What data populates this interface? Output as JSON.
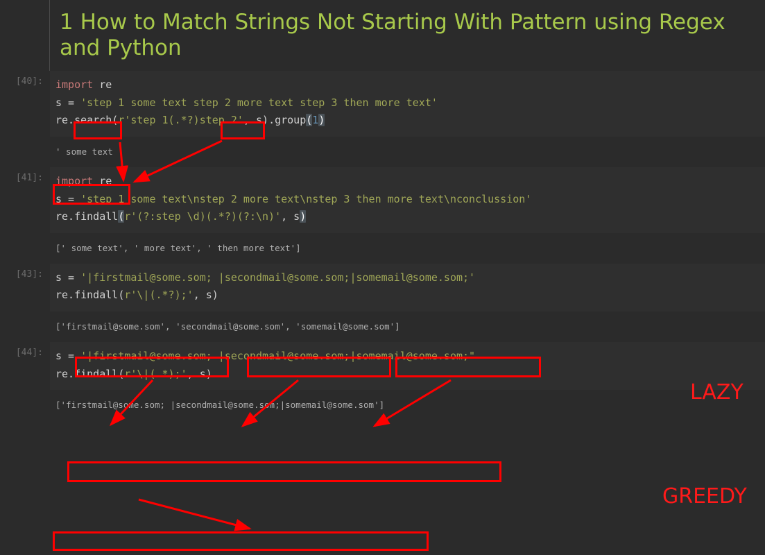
{
  "title": "1  How to Match Strings Not Starting With Pattern using Regex and Python",
  "cells": {
    "c40": {
      "prompt": "[40]:",
      "line1_import": "import",
      "line1_mod": " re",
      "line2_pre": "s = ",
      "line2_str": "'step 1 some text step 2 more text step 3 then more text'",
      "line3_pre": "re.search",
      "line3_open": "(",
      "line3_rstr": "r'step 1(.*?)step 2'",
      "line3_mid": ", s",
      "line3_close": ")",
      "line3_grp": ".group",
      "line3_gopen": "(",
      "line3_num": "1",
      "line3_gclose": ")",
      "output": "' some text '"
    },
    "c41": {
      "prompt": "[41]:",
      "line1_import": "import",
      "line1_mod": " re",
      "line2_pre": "s = ",
      "line2_str": "'step 1 some text\\nstep 2 more text\\nstep 3 then more text\\nconclussion'",
      "line3_pre": "re.findall",
      "line3_open": "(",
      "line3_rstr": "r'(?:step \\d)(.*?)(?:\\n)'",
      "line3_mid": ", s",
      "line3_close": ")",
      "output": "[' some text', ' more text', ' then more text']"
    },
    "c43": {
      "prompt": "[43]:",
      "line1_pre": "s = ",
      "line1_str": "'|firstmail@some.som; |secondmail@some.som;|somemail@some.som;'",
      "line2_pre": "re.findall",
      "line2_open": "(",
      "line2_rstr": "r'\\|(.*?);'",
      "line2_mid": ", s",
      "line2_close": ")",
      "output": "['firstmail@some.som', 'secondmail@some.som', 'somemail@some.som']"
    },
    "c44": {
      "prompt": "[44]:",
      "line1_pre": "s = ",
      "line1_str": "'|firstmail@some.som; |secondmail@some.som;|somemail@some.som;\"",
      "line2_pre": "re.findall",
      "line2_open": "(",
      "line2_rstr": "r'\\|(.*);'",
      "line2_mid": ", s",
      "line2_close": ")",
      "output": "['firstmail@some.som; |secondmail@some.som;|somemail@some.som']"
    }
  },
  "annotations": {
    "lazy": "LAZY",
    "greedy": "GREEDY"
  }
}
